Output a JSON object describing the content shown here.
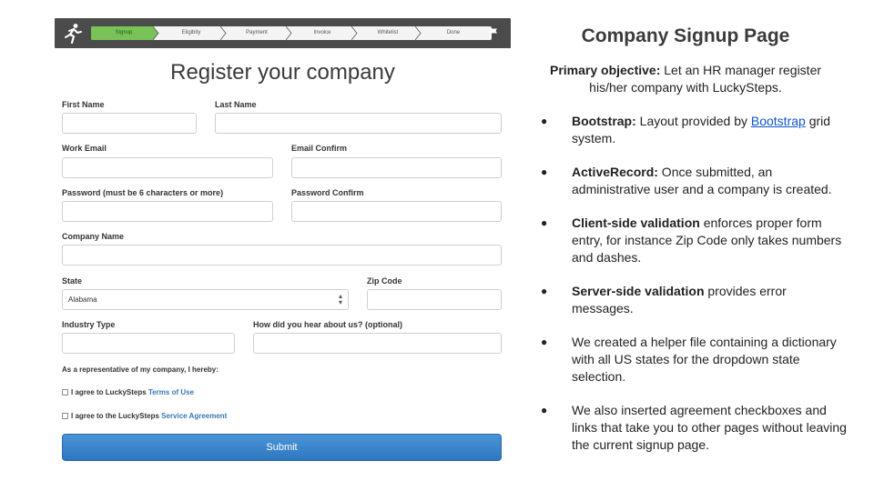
{
  "progress": {
    "steps": [
      "Signup",
      "Eligibity",
      "Payment",
      "Invoice",
      "Whitelist",
      "Done"
    ],
    "active_step": "Signup"
  },
  "form": {
    "title": "Register your company",
    "first_name_label": "First Name",
    "last_name_label": "Last Name",
    "work_email_label": "Work Email",
    "email_confirm_label": "Email Confirm",
    "password_label": "Password (must be 6 characters or more)",
    "password_confirm_label": "Password Confirm",
    "company_name_label": "Company Name",
    "state_label": "State",
    "state_value": "Alabama",
    "zip_label": "Zip Code",
    "industry_label": "Industry Type",
    "hear_label": "How did you hear about us? (optional)",
    "representative_text": "As a representative of my company, I hereby:",
    "agree1_text": "I agree to LuckySteps",
    "agree1_link": "Terms of Use",
    "agree2_text": "I agree to the LuckySteps",
    "agree2_link": "Service Agreement",
    "submit_label": "Submit"
  },
  "slide": {
    "title": "Company Signup Page",
    "objective_label": "Primary objective:",
    "objective_text": " Let an HR manager register his/her company with LuckySteps.",
    "bullets": [
      {
        "bold": "Bootstrap:",
        "text": " Layout provided by ",
        "link": "Bootstrap",
        "after": " grid system."
      },
      {
        "bold": "ActiveRecord:",
        "text": " Once submitted, an administrative user and a company is created."
      },
      {
        "bold": "Client-side validation",
        "text": " enforces proper form entry, for instance Zip Code only takes numbers and dashes."
      },
      {
        "bold": "Server-side validation",
        "text": " provides error messages."
      },
      {
        "bold": "",
        "text": "We created a helper file containing a dictionary with all US states for the dropdown state selection."
      },
      {
        "bold": "",
        "text": "We also inserted agreement checkboxes and links that take you to other pages without leaving the current signup page."
      }
    ]
  },
  "colors": {
    "active_step": "#78c257",
    "topbar": "#4b4b4b",
    "submit": "#3a86cc",
    "link": "#337ab7"
  },
  "icons": [
    "runner-logo-icon",
    "flag-icon"
  ]
}
